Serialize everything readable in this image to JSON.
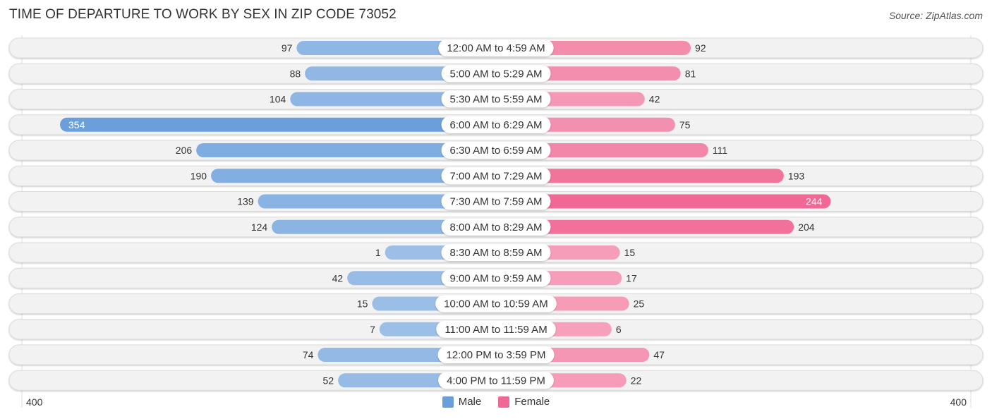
{
  "header": {
    "title": "TIME OF DEPARTURE TO WORK BY SEX IN ZIP CODE 73052",
    "source": "Source: ZipAtlas.com"
  },
  "legend": {
    "male_label": "Male",
    "female_label": "Female"
  },
  "axis": {
    "left_label": "400",
    "right_label": "400"
  },
  "colors": {
    "male": "#6a9fdc",
    "male_light": "#a3c3e8",
    "female": "#f06893",
    "female_light": "#f7a8c0",
    "track": "#f2f2f2"
  },
  "chart_data": {
    "type": "bar",
    "orientation": "horizontal-diverging",
    "title": "TIME OF DEPARTURE TO WORK BY SEX IN ZIP CODE 73052",
    "xlabel": "",
    "ylabel": "",
    "xlim": [
      -400,
      400
    ],
    "legend_position": "bottom",
    "categories": [
      "12:00 AM to 4:59 AM",
      "5:00 AM to 5:29 AM",
      "5:30 AM to 5:59 AM",
      "6:00 AM to 6:29 AM",
      "6:30 AM to 6:59 AM",
      "7:00 AM to 7:29 AM",
      "7:30 AM to 7:59 AM",
      "8:00 AM to 8:29 AM",
      "8:30 AM to 8:59 AM",
      "9:00 AM to 9:59 AM",
      "10:00 AM to 10:59 AM",
      "11:00 AM to 11:59 AM",
      "12:00 PM to 3:59 PM",
      "4:00 PM to 11:59 PM"
    ],
    "series": [
      {
        "name": "Male",
        "side": "left",
        "values": [
          97,
          88,
          104,
          354,
          206,
          190,
          139,
          124,
          1,
          42,
          15,
          7,
          74,
          52
        ]
      },
      {
        "name": "Female",
        "side": "right",
        "values": [
          92,
          81,
          42,
          75,
          111,
          193,
          244,
          204,
          15,
          17,
          25,
          6,
          47,
          22
        ]
      }
    ]
  }
}
